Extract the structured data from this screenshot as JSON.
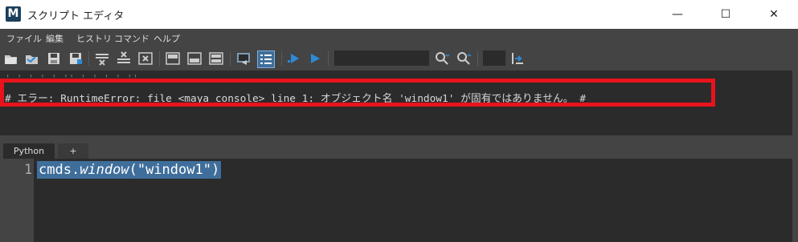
{
  "window": {
    "title": "スクリプト エディタ",
    "app_icon_label": "M",
    "minimize_glyph": "—",
    "maximize_glyph": "☐",
    "close_glyph": "✕"
  },
  "menu": {
    "items": [
      {
        "label": "ファイル"
      },
      {
        "label": "編集"
      },
      {
        "label": "ヒストリ"
      },
      {
        "label": "コマンド"
      },
      {
        "label": "ヘルプ"
      }
    ]
  },
  "history": {
    "ghost_line": "' ' ' ' ' '' ' ' ' ' ''",
    "error_line": "# エラー: RuntimeError: file <maya console> line 1: オブジェクト名 'window1' が固有ではありません。 #"
  },
  "tabs": [
    {
      "label": "Python"
    },
    {
      "label": "+"
    }
  ],
  "editor": {
    "line_number": "1",
    "code_prefix": "cmds.",
    "code_call": "window",
    "code_args": "(\"window1\")"
  },
  "colors": {
    "error_highlight": "#e8131b",
    "selection": "#3f6e9b",
    "panel": "#444444",
    "editor_bg": "#2b2b2b"
  }
}
